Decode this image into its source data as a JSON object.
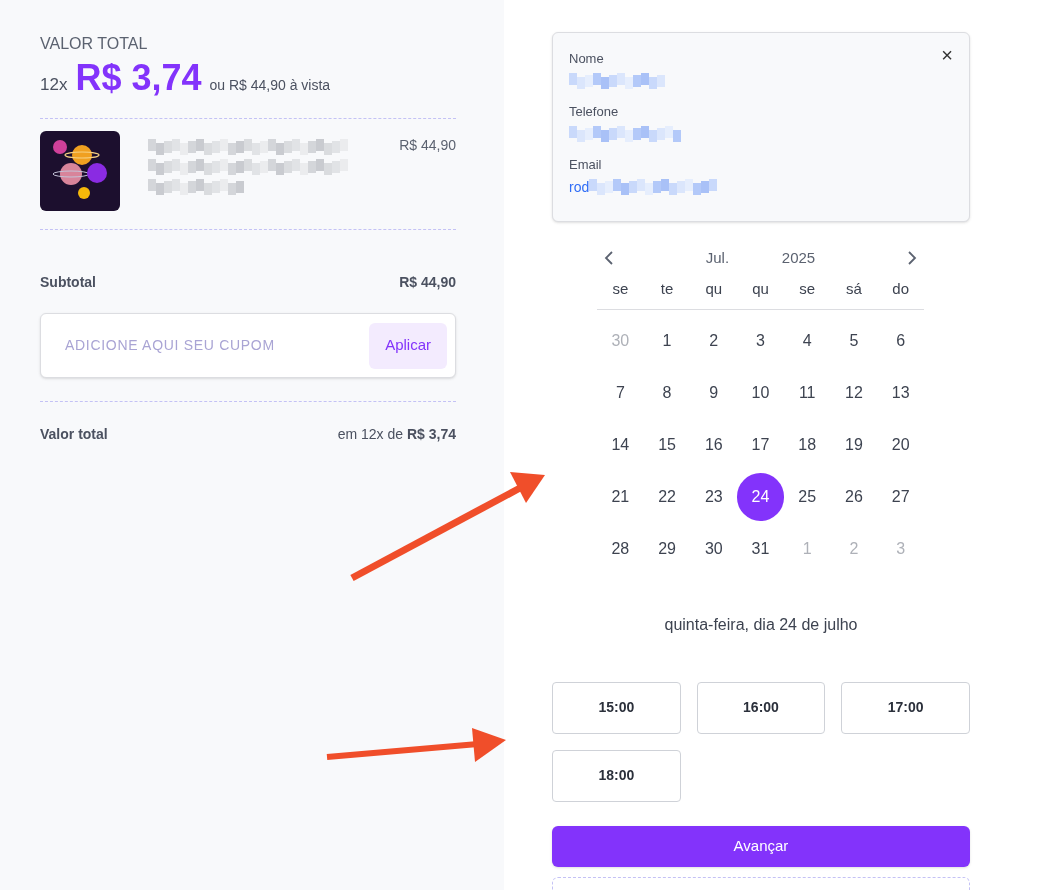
{
  "summary": {
    "heading": "VALOR TOTAL",
    "installments": "12x",
    "installment_price": "R$ 3,74",
    "cash_price": "ou R$ 44,90 à vista"
  },
  "product": {
    "price": "R$ 44,90"
  },
  "subtotal": {
    "label": "Subtotal",
    "value": "R$ 44,90"
  },
  "coupon": {
    "placeholder": "ADICIONE AQUI SEU CUPOM",
    "button": "Aplicar"
  },
  "total": {
    "label": "Valor total",
    "value": "em 12x de **R$ 3,74**"
  },
  "contact": {
    "close": "×",
    "fields": [
      {
        "label": "Nome"
      },
      {
        "label": "Telefone"
      },
      {
        "label": "Email",
        "value": "rod"
      }
    ]
  },
  "calendar": {
    "month": "Jul.",
    "year": "2025",
    "weekdays": [
      "se",
      "te",
      "qu",
      "qu",
      "se",
      "sá",
      "do"
    ],
    "weeks": [
      [
        {
          "day": "30",
          "muted": true,
          "selected": false
        },
        {
          "day": "1",
          "muted": false,
          "selected": false
        },
        {
          "day": "2",
          "muted": false,
          "selected": false
        },
        {
          "day": "3",
          "muted": false,
          "selected": false
        },
        {
          "day": "4",
          "muted": false,
          "selected": false
        },
        {
          "day": "5",
          "muted": false,
          "selected": false
        },
        {
          "day": "6",
          "muted": false,
          "selected": false
        }
      ],
      [
        {
          "day": "7",
          "muted": false,
          "selected": false
        },
        {
          "day": "8",
          "muted": false,
          "selected": false
        },
        {
          "day": "9",
          "muted": false,
          "selected": false
        },
        {
          "day": "10",
          "muted": false,
          "selected": false
        },
        {
          "day": "11",
          "muted": false,
          "selected": false
        },
        {
          "day": "12",
          "muted": false,
          "selected": false
        },
        {
          "day": "13",
          "muted": false,
          "selected": false
        }
      ],
      [
        {
          "day": "14",
          "muted": false,
          "selected": false
        },
        {
          "day": "15",
          "muted": false,
          "selected": false
        },
        {
          "day": "16",
          "muted": false,
          "selected": false
        },
        {
          "day": "17",
          "muted": false,
          "selected": false
        },
        {
          "day": "18",
          "muted": false,
          "selected": false
        },
        {
          "day": "19",
          "muted": false,
          "selected": false
        },
        {
          "day": "20",
          "muted": false,
          "selected": false
        }
      ],
      [
        {
          "day": "21",
          "muted": false,
          "selected": false
        },
        {
          "day": "22",
          "muted": false,
          "selected": false
        },
        {
          "day": "23",
          "muted": false,
          "selected": false
        },
        {
          "day": "24",
          "muted": false,
          "selected": true
        },
        {
          "day": "25",
          "muted": false,
          "selected": false
        },
        {
          "day": "26",
          "muted": false,
          "selected": false
        },
        {
          "day": "27",
          "muted": false,
          "selected": false
        }
      ],
      [
        {
          "day": "28",
          "muted": false,
          "selected": false
        },
        {
          "day": "29",
          "muted": false,
          "selected": false
        },
        {
          "day": "30",
          "muted": false,
          "selected": false
        },
        {
          "day": "31",
          "muted": false,
          "selected": false
        },
        {
          "day": "1",
          "muted": true,
          "selected": false
        },
        {
          "day": "2",
          "muted": true,
          "selected": false
        },
        {
          "day": "3",
          "muted": true,
          "selected": false
        }
      ]
    ]
  },
  "selected_date": "quinta-feira, dia 24 de julho",
  "time_slots": [
    "15:00",
    "16:00",
    "17:00",
    "18:00"
  ],
  "next_button": "Avançar"
}
